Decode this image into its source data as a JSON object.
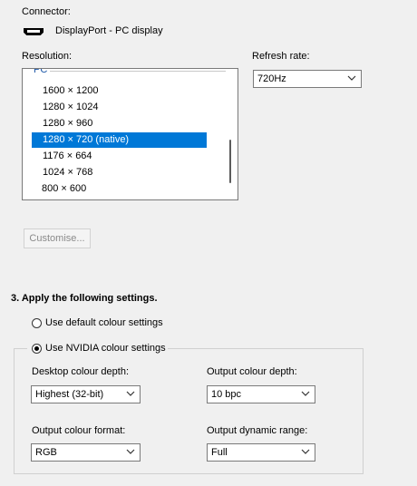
{
  "connector": {
    "label": "Connector:",
    "value": "DisplayPort - PC display",
    "icon": "displayport-icon"
  },
  "resolution": {
    "label": "Resolution:",
    "group": "PC",
    "items": [
      "1600 × 1200",
      "1280 × 1024",
      "1280 × 960",
      "1280 × 720 (native)",
      "1176 × 664",
      "1024 × 768",
      "800 × 600"
    ],
    "selected": "1280 × 720 (native)"
  },
  "refresh": {
    "label": "Refresh rate:",
    "value": "720Hz"
  },
  "customise_label": "Customise...",
  "section3": {
    "title": "3. Apply the following settings.",
    "radio_default": "Use default colour settings",
    "radio_nvidia": "Use NVIDIA colour settings",
    "selected": "nvidia"
  },
  "colour": {
    "desktop_depth_label": "Desktop colour depth:",
    "desktop_depth_value": "Highest (32-bit)",
    "output_depth_label": "Output colour depth:",
    "output_depth_value": "10 bpc",
    "output_format_label": "Output colour format:",
    "output_format_value": "RGB",
    "dynamic_range_label": "Output dynamic range:",
    "dynamic_range_value": "Full"
  },
  "colors": {
    "selection": "#0078d7",
    "group_header": "#1a55a6",
    "background": "#f0f0f0"
  }
}
